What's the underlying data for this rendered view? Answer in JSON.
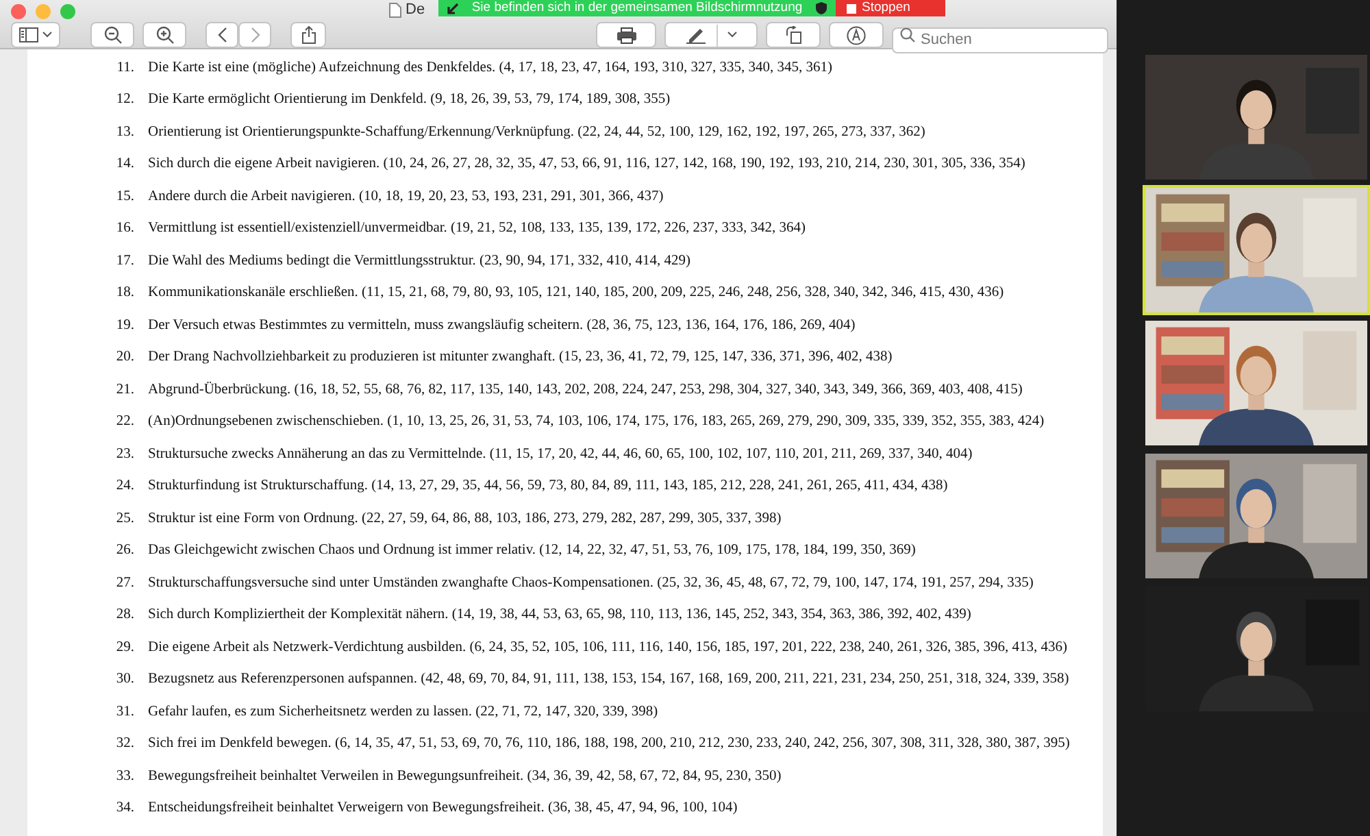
{
  "window": {
    "title": "De"
  },
  "share_banner": {
    "message": "Sie befinden sich in der gemeinsamen Bildschirmnutzung",
    "stop_label": "Stoppen"
  },
  "toolbar": {
    "search_placeholder": "Suchen"
  },
  "items": [
    {
      "number": "11.",
      "text": "Die Karte ist eine (mögliche) Aufzeichnung des Denkfeldes. (4, 17, 18, 23, 47, 164, 193, 310, 327, 335, 340, 345, 361)"
    },
    {
      "number": "12.",
      "text": "Die Karte ermöglicht Orientierung im Denkfeld. (9, 18, 26, 39, 53, 79, 174, 189, 308, 355)"
    },
    {
      "number": "13.",
      "text": "Orientierung ist Orientierungspunkte-Schaffung/Erkennung/Verknüpfung. (22, 24, 44, 52, 100, 129, 162, 192, 197, 265, 273, 337, 362)"
    },
    {
      "number": "14.",
      "text": "Sich durch die eigene Arbeit navigieren. (10, 24, 26, 27, 28, 32, 35, 47, 53, 66, 91, 116, 127, 142, 168, 190, 192, 193, 210, 214, 230, 301, 305, 336, 354)"
    },
    {
      "number": "15.",
      "text": "Andere durch die Arbeit navigieren. (10, 18, 19, 20, 23, 53, 193, 231, 291, 301, 366, 437)"
    },
    {
      "number": "16.",
      "text": "Vermittlung ist essentiell/existenziell/unvermeidbar. (19, 21, 52, 108, 133, 135, 139, 172, 226, 237, 333, 342, 364)"
    },
    {
      "number": "17.",
      "text": "Die Wahl des Mediums bedingt die Vermittlungsstruktur. (23, 90, 94, 171, 332, 410, 414, 429)"
    },
    {
      "number": "18.",
      "text": "Kommunikationskanäle erschließen. (11, 15, 21, 68, 79, 80, 93, 105, 121, 140, 185, 200, 209, 225, 246, 248, 256, 328, 340, 342, 346, 415, 430, 436)"
    },
    {
      "number": "19.",
      "text": "Der Versuch etwas Bestimmtes zu vermitteln, muss zwangsläufig scheitern. (28, 36, 75, 123, 136, 164, 176, 186, 269, 404)"
    },
    {
      "number": "20.",
      "text": "Der Drang Nachvollziehbarkeit zu produzieren ist mitunter zwanghaft. (15, 23, 36, 41, 72, 79, 125, 147, 336, 371, 396, 402, 438)"
    },
    {
      "number": "21.",
      "text": "Abgrund-Überbrückung. (16, 18, 52, 55, 68, 76, 82, 117, 135, 140, 143, 202, 208, 224, 247, 253, 298, 304, 327, 340, 343, 349, 366, 369, 403, 408, 415)"
    },
    {
      "number": "22.",
      "text": "(An)Ordnungsebenen zwischenschieben. (1, 10, 13, 25, 26, 31, 53, 74, 103, 106, 174, 175, 176, 183, 265, 269, 279, 290, 309, 335, 339, 352, 355, 383, 424)"
    },
    {
      "number": "23.",
      "text": "Struktursuche zwecks Annäherung an das zu Vermittelnde. (11, 15, 17, 20, 42, 44, 46, 60, 65, 100, 102, 107, 110, 201, 211, 269, 337, 340, 404)"
    },
    {
      "number": "24.",
      "text": "Strukturfindung ist Strukturschaffung. (14, 13, 27, 29, 35, 44, 56, 59, 73, 80, 84, 89, 111, 143, 185, 212, 228, 241, 261, 265, 411, 434, 438)"
    },
    {
      "number": "25.",
      "text": "Struktur ist eine Form von Ordnung. (22, 27, 59, 64, 86, 88, 103, 186, 273, 279, 282, 287, 299, 305, 337, 398)"
    },
    {
      "number": "26.",
      "text": "Das Gleichgewicht zwischen Chaos und Ordnung ist immer relativ. (12, 14, 22, 32, 47, 51, 53, 76, 109, 175, 178, 184, 199, 350, 369)"
    },
    {
      "number": "27.",
      "text": "Strukturschaffungsversuche sind unter Umständen zwanghafte Chaos-Kompensationen. (25, 32, 36, 45, 48, 67, 72, 79, 100, 147, 174, 191, 257, 294, 335)"
    },
    {
      "number": "28.",
      "text": "Sich durch Kompliziertheit der Komplexität nähern. (14, 19, 38, 44, 53, 63, 65, 98, 110, 113, 136, 145, 252, 343, 354, 363, 386, 392, 402, 439)"
    },
    {
      "number": "29.",
      "text": "Die eigene Arbeit als Netzwerk-Verdichtung ausbilden. (6, 24, 35, 52, 105, 106, 111, 116, 140, 156, 185, 197, 201, 222, 238, 240, 261, 326, 385, 396, 413, 436)"
    },
    {
      "number": "30.",
      "text": "Bezugsnetz aus Referenzpersonen aufspannen. (42, 48, 69, 70, 84, 91, 111, 138, 153, 154, 167, 168, 169, 200, 211, 221, 231, 234, 250, 251, 318, 324, 339, 358)"
    },
    {
      "number": "31.",
      "text": "Gefahr laufen, es zum Sicherheitsnetz werden zu lassen. (22, 71, 72, 147, 320, 339, 398)"
    },
    {
      "number": "32.",
      "text": "Sich frei im Denkfeld bewegen. (6, 14, 35, 47, 51, 53, 69, 70, 76, 110, 186, 188, 198, 200, 210, 212, 230, 233, 240, 242, 256, 307, 308, 311, 328, 380, 387, 395)"
    },
    {
      "number": "33.",
      "text": "Bewegungsfreiheit beinhaltet Verweilen in Bewegungsunfreiheit. (34, 36, 39, 42, 58, 67, 72, 84, 95, 230, 350)"
    },
    {
      "number": "34.",
      "text": "Entscheidungsfreiheit beinhaltet Verweigern von Bewegungsfreiheit. (36, 38, 45, 47, 94, 96, 100, 104)"
    }
  ],
  "video_tiles": [
    {
      "kind": "picture",
      "selected": false
    },
    {
      "kind": "picture",
      "selected": true
    },
    {
      "kind": "picture",
      "selected": false
    },
    {
      "kind": "picture",
      "selected": false
    },
    {
      "kind": "picture",
      "selected": false
    }
  ]
}
